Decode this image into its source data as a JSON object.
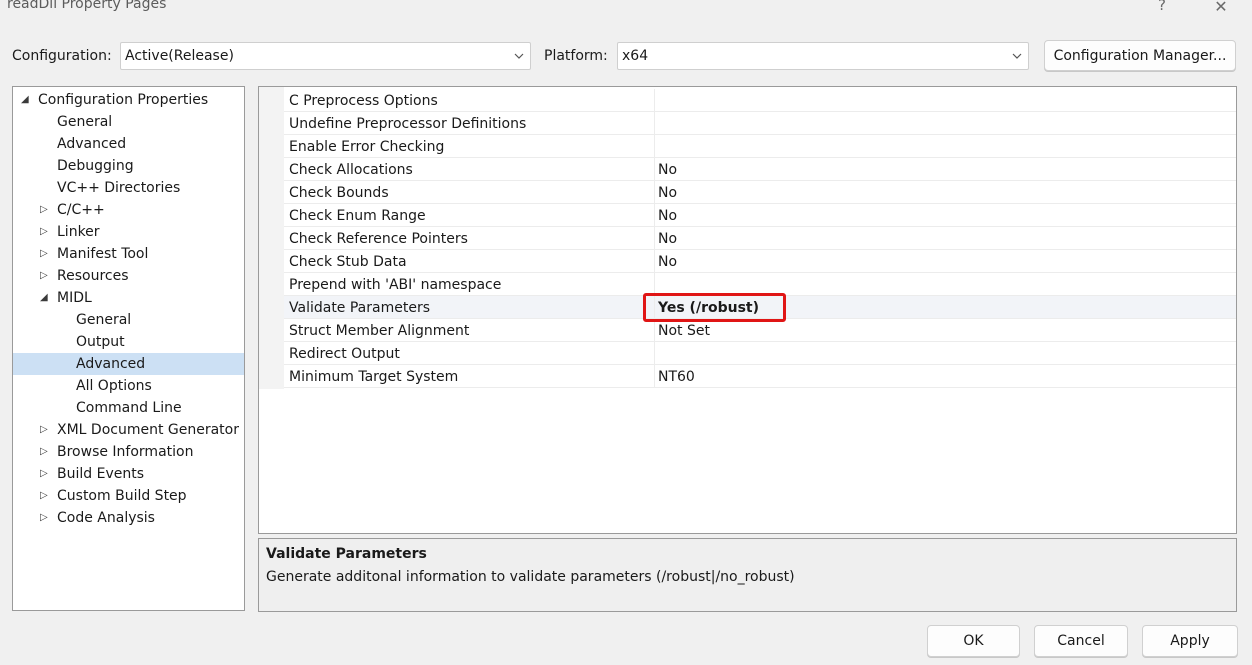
{
  "window": {
    "title": "readDll Property Pages",
    "help_label": "?",
    "close_label": "✕"
  },
  "toolbar": {
    "configuration_label": "Configuration:",
    "configuration_value": "Active(Release)",
    "platform_label": "Platform:",
    "platform_value": "x64",
    "config_manager_label": "Configuration Manager..."
  },
  "tree": {
    "items": [
      {
        "label": "Configuration Properties",
        "arrow": "◢"
      },
      {
        "label": "General"
      },
      {
        "label": "Advanced"
      },
      {
        "label": "Debugging"
      },
      {
        "label": "VC++ Directories"
      },
      {
        "label": "C/C++",
        "arrow": "▷"
      },
      {
        "label": "Linker",
        "arrow": "▷"
      },
      {
        "label": "Manifest Tool",
        "arrow": "▷"
      },
      {
        "label": "Resources",
        "arrow": "▷"
      },
      {
        "label": "MIDL",
        "arrow": "◢"
      },
      {
        "label": "General"
      },
      {
        "label": "Output"
      },
      {
        "label": "Advanced",
        "selected": true
      },
      {
        "label": "All Options"
      },
      {
        "label": "Command Line"
      },
      {
        "label": "XML Document Generator",
        "arrow": "▷"
      },
      {
        "label": "Browse Information",
        "arrow": "▷"
      },
      {
        "label": "Build Events",
        "arrow": "▷"
      },
      {
        "label": "Custom Build Step",
        "arrow": "▷"
      },
      {
        "label": "Code Analysis",
        "arrow": "▷"
      }
    ]
  },
  "properties": {
    "rows": [
      {
        "name": "C Preprocess Options",
        "value": ""
      },
      {
        "name": "Undefine Preprocessor Definitions",
        "value": ""
      },
      {
        "name": "Enable Error Checking",
        "value": ""
      },
      {
        "name": "Check Allocations",
        "value": "No"
      },
      {
        "name": "Check Bounds",
        "value": "No"
      },
      {
        "name": "Check Enum Range",
        "value": "No"
      },
      {
        "name": "Check Reference Pointers",
        "value": "No"
      },
      {
        "name": "Check Stub Data",
        "value": "No"
      },
      {
        "name": "Prepend with 'ABI' namespace",
        "value": ""
      },
      {
        "name": "Validate Parameters",
        "value": "Yes (/robust)",
        "selected": true
      },
      {
        "name": "Struct Member Alignment",
        "value": "Not Set"
      },
      {
        "name": "Redirect Output",
        "value": ""
      },
      {
        "name": "Minimum Target System",
        "value": "NT60"
      }
    ]
  },
  "description": {
    "title": "Validate Parameters",
    "text": "Generate additonal information to validate parameters (/robust|/no_robust)"
  },
  "buttons": {
    "ok": "OK",
    "cancel": "Cancel",
    "apply": "Apply"
  },
  "colors": {
    "selection": "#cce0f4",
    "highlight_box": "#e01515"
  }
}
